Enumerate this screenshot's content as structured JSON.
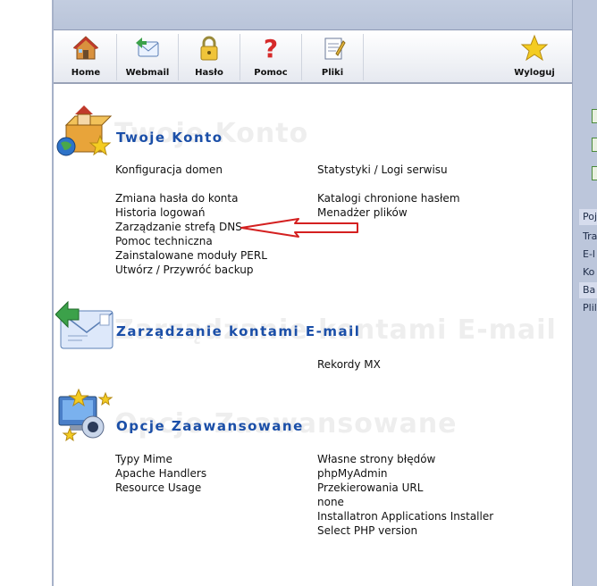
{
  "toolbar": {
    "home": "Home",
    "webmail": "Webmail",
    "password": "Hasło",
    "help": "Pomoc",
    "files": "Pliki",
    "logout": "Wyloguj"
  },
  "sidebar": {
    "items": [
      "Poj",
      "Tra",
      "E-l",
      "Ko",
      "Ba",
      "Plil"
    ]
  },
  "account": {
    "title": "Twoje Konto",
    "col1": [
      "Konfiguracja domen",
      "Zmiana hasła do konta",
      "Historia logowań",
      "Zarządzanie strefą DNS",
      "Pomoc techniczna",
      "Zainstalowane moduły PERL",
      "Utwórz / Przywróć backup"
    ],
    "col2": [
      "Statystyki / Logi serwisu",
      "Katalogi chronione hasłem",
      "Menadżer plików"
    ]
  },
  "email": {
    "title": "Zarządzanie kontami E-mail",
    "col2": [
      "Rekordy MX"
    ]
  },
  "advanced": {
    "title": "Opcje Zaawansowane",
    "col1": [
      "Typy Mime",
      "Apache Handlers",
      "Resource Usage"
    ],
    "col2": [
      "Własne strony błędów",
      "phpMyAdmin",
      "Przekierowania URL",
      "none",
      "Installatron Applications Installer",
      "Select PHP version"
    ]
  },
  "colors": {
    "title": "#1b4fa8",
    "arrow": "#d42020",
    "frame": "#bcc6db"
  }
}
